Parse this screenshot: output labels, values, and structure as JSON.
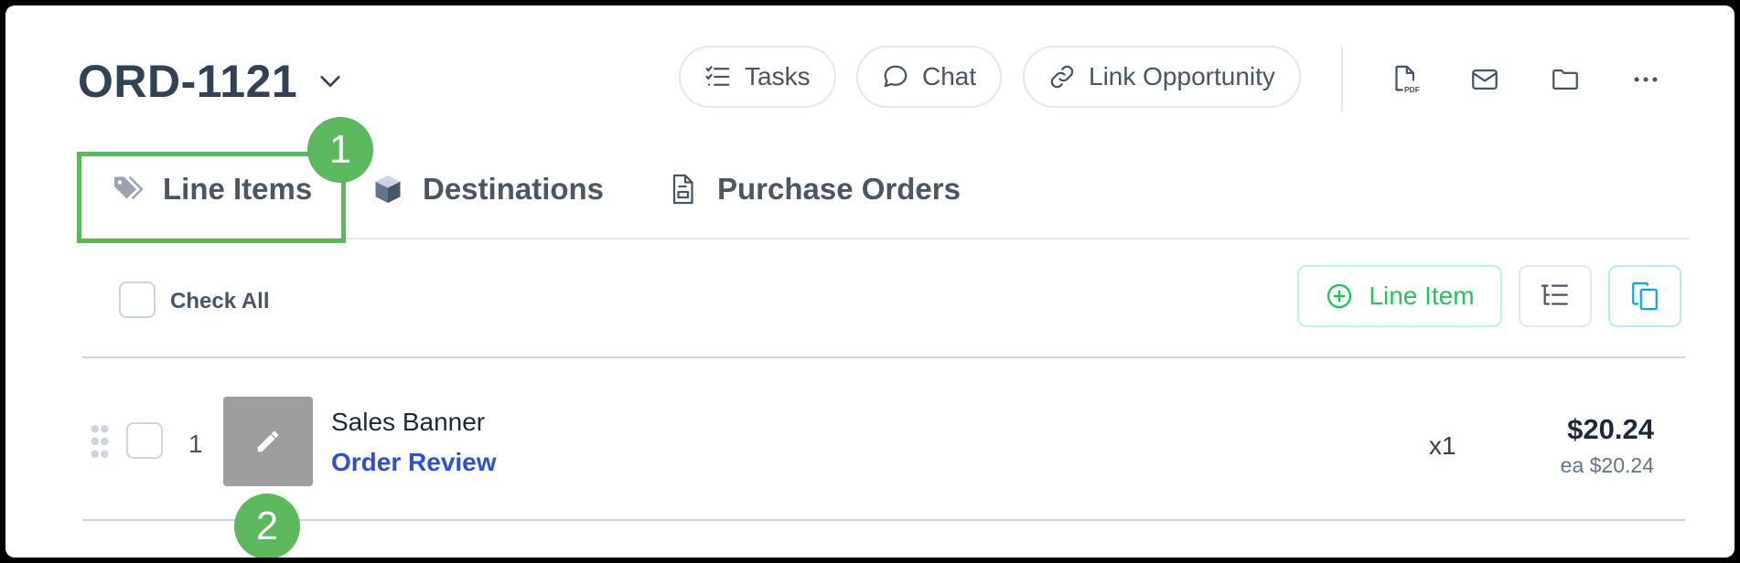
{
  "order": {
    "title": "ORD-1121"
  },
  "header_buttons": {
    "tasks": "Tasks",
    "chat": "Chat",
    "link_opportunity": "Link Opportunity"
  },
  "header_icons": [
    "pdf-icon",
    "mail-icon",
    "folder-icon",
    "more-icon"
  ],
  "tabs": [
    {
      "label": "Line Items",
      "icon": "tag-icon"
    },
    {
      "label": "Destinations",
      "icon": "box-icon"
    },
    {
      "label": "Purchase Orders",
      "icon": "document-icon"
    }
  ],
  "toolbar": {
    "check_all": "Check All",
    "add_line_item": "Line Item"
  },
  "line_items": [
    {
      "number": "1",
      "name": "Sales Banner",
      "status_link": "Order Review",
      "quantity": "x1",
      "total": "$20.24",
      "each": "ea $20.24"
    }
  ],
  "annotations": {
    "badge_1": "1",
    "badge_2": "2"
  },
  "colors": {
    "accent_green": "#5cb85c",
    "link_blue": "#2f4fd8",
    "text_dark": "#334155"
  }
}
